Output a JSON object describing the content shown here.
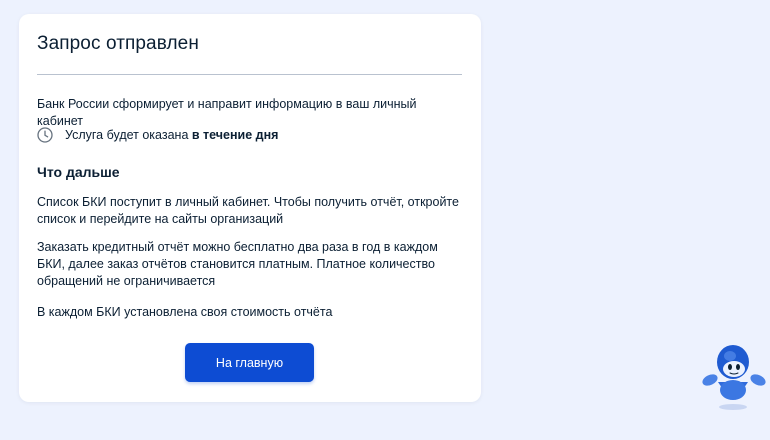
{
  "card": {
    "title": "Запрос отправлен",
    "info_text": "Банк России сформирует и направит информацию в ваш личный кабинет",
    "service_prefix": "Услуга будет оказана ",
    "service_emphasis": "в течение дня",
    "service_icon": "clock-icon",
    "next_heading": "Что дальше",
    "paragraphs": [
      "Список БКИ поступит в личный кабинет. Чтобы получить отчёт, откройте список и перейдите на сайты организаций",
      "Заказать кредитный отчёт можно бесплатно два раза в год в каждом БКИ, далее заказ отчётов становится платным. Платное количество обращений не ограничивается",
      "В каждом БКИ установлена своя стоимость отчёта"
    ],
    "button_label": "На главную"
  },
  "assistant": {
    "icon": "robot-assistant-icon"
  },
  "colors": {
    "background": "#edf2fe",
    "card": "#ffffff",
    "primary_button": "#0d4cd3",
    "text": "#0b1f33",
    "divider": "#b9c2cf"
  }
}
